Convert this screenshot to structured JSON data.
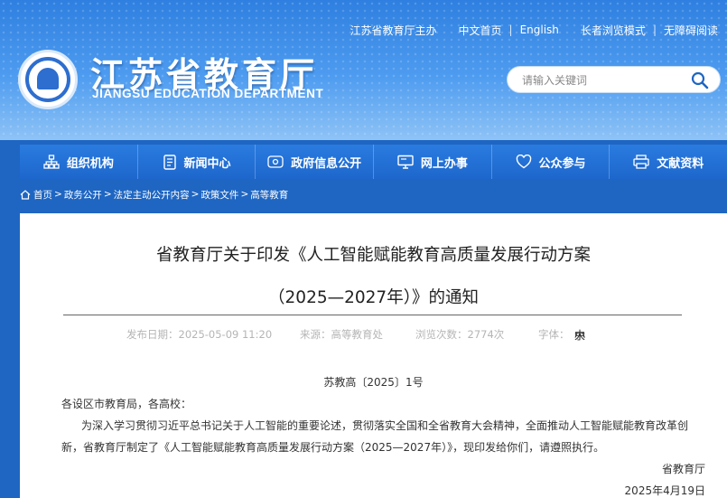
{
  "topnav": {
    "host": "江苏省教育厅主办",
    "home_cn": "中文首页",
    "english": "English",
    "elder_mode": "长者浏览模式",
    "accessible": "无障碍阅读"
  },
  "header": {
    "title": "江苏省教育厅",
    "subtitle": "JIANGSU EDUCATION DEPARTMENT",
    "search_placeholder": "请输入关键词"
  },
  "mainnav": {
    "items": [
      {
        "label": "组织机构",
        "icon": "org-chart-icon"
      },
      {
        "label": "新闻中心",
        "icon": "document-icon"
      },
      {
        "label": "政府信息公开",
        "icon": "info-eye-icon"
      },
      {
        "label": "网上办事",
        "icon": "monitor-icon"
      },
      {
        "label": "公众参与",
        "icon": "heart-icon"
      },
      {
        "label": "文献资料",
        "icon": "printer-icon"
      }
    ]
  },
  "breadcrumb": {
    "items": [
      "首页",
      "政务公开",
      "法定主动公开内容",
      "政策文件",
      "高等教育"
    ]
  },
  "article": {
    "title_line1": "省教育厅关于印发《人工智能赋能教育高质量发展行动方案",
    "title_line2": "（2025—2027年）》的通知",
    "publish_label": "发布日期：",
    "publish_date": "2025-05-09 11:20",
    "source_label": "来源：",
    "source": "高等教育处",
    "views_label": "浏览次数：",
    "views": "2774次",
    "fontsize_label": "字体：",
    "fontsize_large": "大",
    "fontsize_medium": "中",
    "fontsize_small": "小",
    "doc_number": "苏教高〔2025〕1号",
    "salutation": "各设区市教育局，各高校：",
    "body_line1": "为深入学习贯彻习近平总书记关于人工智能的重要论述，贯彻落实全国和全省教育大会精神，全面推动人工智能赋能教育改革创",
    "body_line2": "新，省教育厅制定了《人工智能赋能教育高质量发展行动方案（2025—2027年）》，现印发给你们，请遵照执行。",
    "signature": "省教育厅",
    "sign_date": "2025年4月19日"
  },
  "colors": {
    "brand_blue": "#1f66c2",
    "nav_blue": "#2a7be0"
  }
}
